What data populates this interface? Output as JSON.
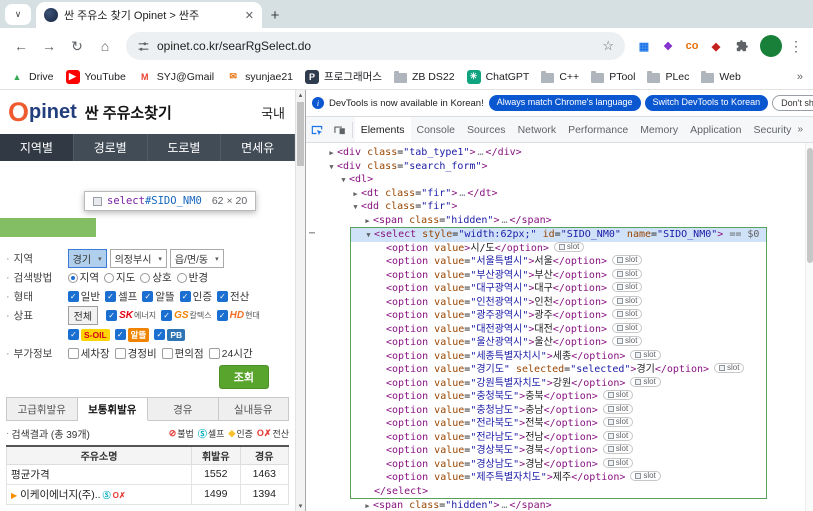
{
  "browser": {
    "tab_title": "싼 주유소 찾기 Opinet > 싼주",
    "url": "opinet.co.kr/searRgSelect.do",
    "icons": {
      "tab_search": "∨",
      "close": "✕",
      "new_tab": "+",
      "back": "←",
      "forward": "→",
      "reload": "↻",
      "home": "⌂",
      "star": "☆",
      "menu": "⋮",
      "overflow": "»"
    },
    "extensions": [
      {
        "label": "▦",
        "color": "#1a73e8"
      },
      {
        "label": "❖",
        "color": "#8430ce"
      },
      {
        "label": "co",
        "color": "#e8710a"
      },
      {
        "label": "◆",
        "color": "#c5221f"
      }
    ],
    "bookmarks": [
      {
        "label": "Drive",
        "glyph": "▲",
        "color": "#34a853"
      },
      {
        "label": "YouTube",
        "glyph": "▶",
        "color": "#ffffff",
        "bg": "#ff0000"
      },
      {
        "label": "SYJ@Gmail",
        "glyph": "M",
        "color": "#ea4335"
      },
      {
        "label": "syunjae21",
        "glyph": "✉",
        "color": "#e8710a"
      },
      {
        "label": "프로그래머스",
        "glyph": "P",
        "color": "#ffffff",
        "bg": "#2f3c4e"
      },
      {
        "label": "ZB DS22",
        "folder": true
      },
      {
        "label": "ChatGPT",
        "glyph": "✳",
        "color": "#ffffff",
        "bg": "#10a37f"
      },
      {
        "label": "C++",
        "folder": true
      },
      {
        "label": "PTool",
        "folder": true
      },
      {
        "label": "PLec",
        "folder": true
      },
      {
        "label": "Web",
        "folder": true
      }
    ]
  },
  "site": {
    "bullet": "·",
    "logo_first": "O",
    "logo_rest": "pinet",
    "title": "싼 주유소찾기",
    "header_menu": "국내",
    "menu_tabs": [
      {
        "label": "지역별",
        "active": true
      },
      {
        "label": "경로별"
      },
      {
        "label": "도로별"
      },
      {
        "label": "면세유"
      }
    ],
    "inspect_tooltip": {
      "tag": "select",
      "id": "#SIDO_NM0",
      "size": "62 × 20"
    },
    "form": {
      "region_label": "지역",
      "region_selects": [
        {
          "value": "경기",
          "inspected": true
        },
        {
          "value": "의정부시"
        },
        {
          "value": "읍/면/동"
        }
      ],
      "method_label": "검색방법",
      "methods": [
        {
          "label": "지역",
          "checked": true
        },
        {
          "label": "지도"
        },
        {
          "label": "상호"
        },
        {
          "label": "반경"
        }
      ],
      "type_label": "형태",
      "types": [
        {
          "label": "일반",
          "checked": true
        },
        {
          "label": "셀프",
          "checked": true
        },
        {
          "label": "알뜰",
          "checked": true
        },
        {
          "label": "인증",
          "checked": true
        },
        {
          "label": "전산",
          "checked": true
        }
      ],
      "brand_label": "상표",
      "brand_all": "전체",
      "brands_row1": [
        {
          "short": "SK",
          "rest": "에너지",
          "color": "#e60012",
          "checked": true
        },
        {
          "short": "GS",
          "rest": "칼텍스",
          "color": "#f08300",
          "checked": true
        },
        {
          "short": "HD",
          "rest": "현대",
          "color": "#f36f21",
          "checked": true
        }
      ],
      "brands_row2": [
        {
          "short": "S-OIL",
          "bg": "#ffd400",
          "fg": "#d6001c",
          "checked": true
        },
        {
          "short": "알뜰",
          "bg": "#f08300",
          "fg": "#ffffff",
          "checked": true
        },
        {
          "short": "PB",
          "bg": "#2e75b6",
          "fg": "#ffffff",
          "checked": true
        }
      ],
      "extra_label": "부가정보",
      "extras": [
        {
          "label": "세차장"
        },
        {
          "label": "경정비"
        },
        {
          "label": "편의점"
        },
        {
          "label": "24시간"
        }
      ],
      "submit_label": "조회"
    },
    "fuel_tabs": [
      {
        "label": "고급휘발유"
      },
      {
        "label": "보통휘발유",
        "active": true
      },
      {
        "label": "경유"
      },
      {
        "label": "실내등유"
      }
    ],
    "result_label": "검색결과 (총 39개)",
    "legend": [
      {
        "icon": "⊘",
        "color": "#e53935",
        "label": "불법"
      },
      {
        "icon": "Ⓢ",
        "color": "#00acc1",
        "label": "셀프"
      },
      {
        "icon": "◆",
        "color": "#fbc02d",
        "label": "인증"
      },
      {
        "icon": "O✗",
        "color": "#e53935",
        "label": "전산"
      }
    ],
    "table": {
      "headers": [
        "주유소명",
        "휘발유",
        "경유"
      ],
      "rows": [
        {
          "name": "평균가격",
          "values": [
            "1552",
            "1463"
          ]
        },
        {
          "name": "이케이에너지(주)..",
          "values": [
            "1499",
            "1394"
          ],
          "marker": {
            "glyph": "▶",
            "color": "#fb8c00"
          },
          "badges": [
            {
              "t": "Ⓢ",
              "c": "#00acc1"
            },
            {
              "t": "O✗",
              "c": "#e53935"
            }
          ]
        }
      ]
    }
  },
  "devtools": {
    "banner": {
      "info_icon": "i",
      "text": "DevTools is now available in Korean!",
      "buttons": [
        {
          "label": "Always match Chrome's language",
          "style": "primary"
        },
        {
          "label": "Switch DevTools to Korean",
          "style": "primary"
        },
        {
          "label": "Don't show again",
          "style": "secondary"
        }
      ]
    },
    "tabs": [
      {
        "label": "Elements",
        "active": true
      },
      {
        "label": "Console"
      },
      {
        "label": "Sources"
      },
      {
        "label": "Network"
      },
      {
        "label": "Performance"
      },
      {
        "label": "Memory"
      },
      {
        "label": "Application"
      },
      {
        "label": "Security"
      }
    ],
    "more_tabs_icon": "»",
    "gutter_dots": "⋯",
    "tree": {
      "lines": [
        {
          "indent": 1,
          "arrow": "r",
          "tag": "div",
          "attrs": [
            [
              "class",
              "tab_type1"
            ]
          ],
          "collapsed": true
        },
        {
          "indent": 1,
          "arrow": "d",
          "tag": "div",
          "attrs": [
            [
              "class",
              "search_form"
            ]
          ]
        },
        {
          "indent": 2,
          "arrow": "d",
          "tag": "dl"
        },
        {
          "indent": 3,
          "arrow": "r",
          "tag": "dt",
          "attrs": [
            [
              "class",
              "fir"
            ]
          ],
          "collapsed": true
        },
        {
          "indent": 3,
          "arrow": "d",
          "tag": "dd",
          "attrs": [
            [
              "class",
              "fir"
            ]
          ]
        },
        {
          "indent": 4,
          "arrow": "r",
          "tag": "span",
          "attrs": [
            [
              "class",
              "hidden"
            ]
          ],
          "collapsed": true
        },
        {
          "indent": 4,
          "arrow": "d",
          "tag": "select",
          "attrs": [
            [
              "style",
              "width:62px;"
            ],
            [
              "id",
              "SIDO_NM0"
            ],
            [
              "name",
              "SIDO_NM0"
            ]
          ],
          "selected": true,
          "marker": "== $0",
          "box": true
        },
        {
          "indent": 5,
          "tag": "option",
          "attrs": [
            [
              "value",
              null
            ]
          ],
          "text": "시/도",
          "close": true,
          "badge": "slot",
          "box": true
        },
        {
          "indent": 5,
          "tag": "option",
          "attrs": [
            [
              "value",
              "서울특별시"
            ]
          ],
          "text": "서울",
          "close": true,
          "badge": "slot",
          "box": true
        },
        {
          "indent": 5,
          "tag": "option",
          "attrs": [
            [
              "value",
              "부산광역시"
            ]
          ],
          "text": "부산",
          "close": true,
          "badge": "slot",
          "box": true
        },
        {
          "indent": 5,
          "tag": "option",
          "attrs": [
            [
              "value",
              "대구광역시"
            ]
          ],
          "text": "대구",
          "close": true,
          "badge": "slot",
          "box": true
        },
        {
          "indent": 5,
          "tag": "option",
          "attrs": [
            [
              "value",
              "인천광역시"
            ]
          ],
          "text": "인천",
          "close": true,
          "badge": "slot",
          "box": true
        },
        {
          "indent": 5,
          "tag": "option",
          "attrs": [
            [
              "value",
              "광주광역시"
            ]
          ],
          "text": "광주",
          "close": true,
          "badge": "slot",
          "box": true
        },
        {
          "indent": 5,
          "tag": "option",
          "attrs": [
            [
              "value",
              "대전광역시"
            ]
          ],
          "text": "대전",
          "close": true,
          "badge": "slot",
          "box": true
        },
        {
          "indent": 5,
          "tag": "option",
          "attrs": [
            [
              "value",
              "울산광역시"
            ]
          ],
          "text": "울산",
          "close": true,
          "badge": "slot",
          "box": true
        },
        {
          "indent": 5,
          "tag": "option",
          "attrs": [
            [
              "value",
              "세종특별자치시"
            ]
          ],
          "text": "세종",
          "close": true,
          "badge": "slot",
          "box": true
        },
        {
          "indent": 5,
          "tag": "option",
          "attrs": [
            [
              "value",
              "경기도"
            ],
            [
              "selected",
              "selected"
            ]
          ],
          "text": "경기",
          "close": true,
          "badge": "slot",
          "box": true
        },
        {
          "indent": 5,
          "tag": "option",
          "attrs": [
            [
              "value",
              "강원특별자치도"
            ]
          ],
          "text": "강원",
          "close": true,
          "badge": "slot",
          "box": true
        },
        {
          "indent": 5,
          "tag": "option",
          "attrs": [
            [
              "value",
              "충청북도"
            ]
          ],
          "text": "충북",
          "close": true,
          "badge": "slot",
          "box": true
        },
        {
          "indent": 5,
          "tag": "option",
          "attrs": [
            [
              "value",
              "충청남도"
            ]
          ],
          "text": "충남",
          "close": true,
          "badge": "slot",
          "box": true
        },
        {
          "indent": 5,
          "tag": "option",
          "attrs": [
            [
              "value",
              "전라북도"
            ]
          ],
          "text": "전북",
          "close": true,
          "badge": "slot",
          "box": true
        },
        {
          "indent": 5,
          "tag": "option",
          "attrs": [
            [
              "value",
              "전라남도"
            ]
          ],
          "text": "전남",
          "close": true,
          "badge": "slot",
          "box": true
        },
        {
          "indent": 5,
          "tag": "option",
          "attrs": [
            [
              "value",
              "경상북도"
            ]
          ],
          "text": "경북",
          "close": true,
          "badge": "slot",
          "box": true
        },
        {
          "indent": 5,
          "tag": "option",
          "attrs": [
            [
              "value",
              "경상남도"
            ]
          ],
          "text": "경남",
          "close": true,
          "badge": "slot",
          "box": true
        },
        {
          "indent": 5,
          "tag": "option",
          "attrs": [
            [
              "value",
              "제주특별자치도"
            ]
          ],
          "text": "제주",
          "close": true,
          "badge": "slot",
          "box": true
        },
        {
          "indent": 4,
          "closeOnly": "select",
          "box": true
        },
        {
          "indent": 4,
          "arrow": "r",
          "tag": "span",
          "attrs": [
            [
              "class",
              "hidden"
            ]
          ],
          "collapsed": true
        }
      ]
    }
  }
}
